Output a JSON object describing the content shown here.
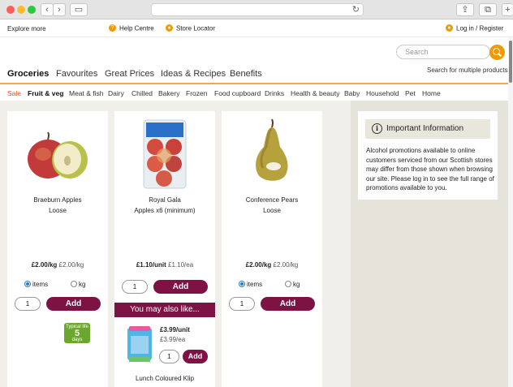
{
  "util": {
    "explore": "Explore more",
    "help": "Help Centre",
    "store": "Store Locator",
    "login": "Log in / Register"
  },
  "search": {
    "placeholder": "Search",
    "multi": "Search for multiple products"
  },
  "mainnav": [
    "Groceries",
    "Favourites",
    "Great Prices",
    "Ideas & Recipes",
    "Benefits"
  ],
  "catnav": [
    "Sale",
    "Fruit & veg",
    "Meat & fish",
    "Dairy",
    "Chilled",
    "Bakery",
    "Frozen",
    "Food cupboard",
    "Drinks",
    "Health & beauty",
    "Baby",
    "Household",
    "Pet",
    "Home"
  ],
  "products": [
    {
      "name1": "Braeburn Apples",
      "name2": "Loose",
      "price": "£2.00/kg",
      "unit": "£2.00/kg",
      "qty": "1",
      "add": "Add",
      "opt1": "items",
      "opt2": "kg"
    },
    {
      "name1": "Royal Gala",
      "name2": "Apples x6 (minimum)",
      "price": "£1.10/unit",
      "unit": "£1.10/ea",
      "qty": "1",
      "add": "Add"
    },
    {
      "name1": "Conference Pears",
      "name2": "Loose",
      "price": "£2.00/kg",
      "unit": "£2.00/kg",
      "qty": "1",
      "add": "Add",
      "opt1": "items",
      "opt2": "kg"
    }
  ],
  "youmay": "You may also like...",
  "suggestion": {
    "price": "£3.99/unit",
    "unit": "£3.99/ea",
    "qty": "1",
    "add": "Add",
    "name": "Lunch Coloured Klip"
  },
  "badge": {
    "line1": "Typical life",
    "line2": "5",
    "line3": "days"
  },
  "info": {
    "title": "Important Information",
    "text": "Alcohol promotions available to online customers serviced from our Scottish stores may differ from those shown when browsing our site. Please log in to see the full range of promotions available to you."
  }
}
